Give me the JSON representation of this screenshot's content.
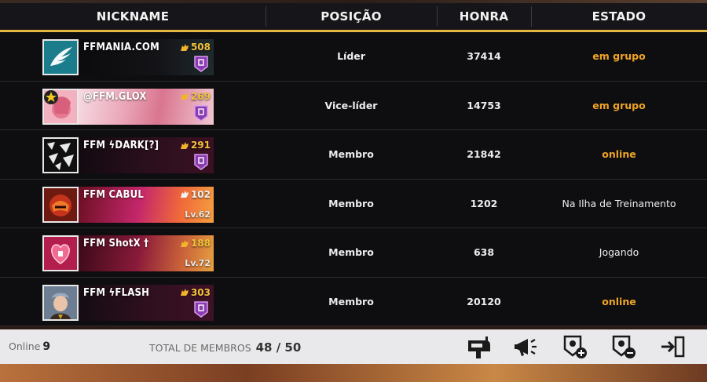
{
  "header": {
    "nickname": "NICKNAME",
    "posicao": "POSIÇÃO",
    "honra": "HONRA",
    "estado": "ESTADO"
  },
  "members": [
    {
      "nick": "FFMANIA.COM",
      "score": "508",
      "extra": "",
      "posicao": "Líder",
      "honra": "37414",
      "estado": "em grupo",
      "estado_color": "gold"
    },
    {
      "nick": "@FFM.GLOX",
      "score": "269",
      "extra": "",
      "posicao": "Vice-líder",
      "honra": "14753",
      "estado": "em grupo",
      "estado_color": "gold"
    },
    {
      "nick": "FFM   ϟDARK[?]",
      "score": "291",
      "extra": "",
      "posicao": "Membro",
      "honra": "21842",
      "estado": "online",
      "estado_color": "gold"
    },
    {
      "nick": "FFM   CABUL",
      "score": "102",
      "extra": "Lv.62",
      "posicao": "Membro",
      "honra": "1202",
      "estado": "Na Ilha de Treinamento",
      "estado_color": "white"
    },
    {
      "nick": "FFM   ShotX  †",
      "score": "188",
      "extra": "Lv.72",
      "posicao": "Membro",
      "honra": "638",
      "estado": "Jogando",
      "estado_color": "white"
    },
    {
      "nick": "FFM   ϟFLASH",
      "score": "303",
      "extra": "",
      "posicao": "Membro",
      "honra": "20120",
      "estado": "online",
      "estado_color": "gold"
    }
  ],
  "footer": {
    "online_label": "Online",
    "online_count": "9",
    "total_label": "TOTAL DE MEMBROS",
    "total_value": "48 / 50"
  },
  "icons": {
    "mailbox": "mailbox-icon",
    "megaphone": "megaphone-icon",
    "add_member": "add-member-icon",
    "remove_member": "remove-member-icon",
    "exit": "exit-icon"
  },
  "colors": {
    "gold": "#f0a425",
    "header_line": "#e4b640"
  }
}
